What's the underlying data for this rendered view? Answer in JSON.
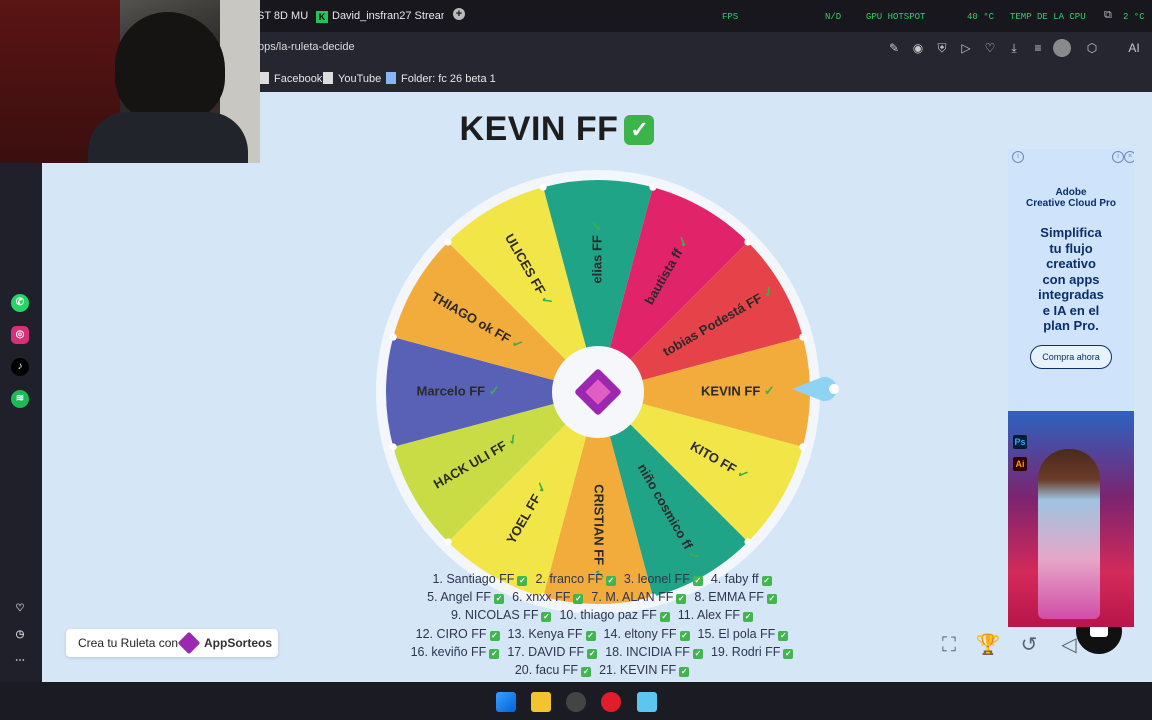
{
  "browser": {
    "tabs": [
      {
        "label": "ST 8D MU"
      },
      {
        "label": "David_insfran27 Stream -",
        "icon": "K"
      }
    ],
    "hud": {
      "fps_label": "FPS",
      "nd_label": "N/D",
      "gpu_label": "GPU HOTSPOT",
      "gpu_temp": "40 °C",
      "cpu_label": "TEMP DE LA CPU",
      "cpu_value": "2 °C"
    },
    "url": "pps/la-ruleta-decide",
    "ai_label": "AI",
    "bookmarks": [
      {
        "label": "Facebook"
      },
      {
        "label": "YouTube"
      },
      {
        "label": "Folder: fc 26 beta 1"
      }
    ]
  },
  "wheel": {
    "title": "KEVIN FF",
    "title_check": "✓",
    "accent": "#9c27b0",
    "pointer_color": "#8fd3f4",
    "segments": [
      {
        "label": "elias FF",
        "color": "#20a487"
      },
      {
        "label": "bautista ff",
        "color": "#e1246a"
      },
      {
        "label": "tobias Podestá FF",
        "color": "#e6424a"
      },
      {
        "label": "KEVIN FF",
        "color": "#f2ac3b"
      },
      {
        "label": "KITO FF",
        "color": "#f2e548"
      },
      {
        "label": "niño cosmico ff",
        "color": "#20a487"
      },
      {
        "label": "CRISTIAN FF",
        "color": "#f2ac3b"
      },
      {
        "label": "YOEL FF",
        "color": "#f2e548"
      },
      {
        "label": "HACK ULI FF",
        "color": "#c9dc45"
      },
      {
        "label": "Marcelo FF",
        "color": "#5861b6"
      },
      {
        "label": "THIAGO ok FF",
        "color": "#f2ac3b"
      },
      {
        "label": "ULICES FF",
        "color": "#f2e548"
      }
    ]
  },
  "participants": [
    [
      "1. Santiago FF",
      "2. franco FF",
      "3. leonel FF",
      "4. faby ff"
    ],
    [
      "5. Angel FF",
      "6. xnxx FF",
      "7. M. ALAN FF",
      "8. EMMA FF"
    ],
    [
      "9. NICOLAS FF",
      "10. thiago paz FF",
      "11. Alex FF"
    ],
    [
      "12. CIRO FF",
      "13. Kenya FF",
      "14. eltony FF",
      "15. El pola FF"
    ],
    [
      "16. keviño FF",
      "17. DAVID FF",
      "18. INCIDIA FF",
      "19. Rodri FF"
    ],
    [
      "20. facu FF",
      "21. KEVIN FF"
    ]
  ],
  "badge": {
    "prefix": "Crea tu Ruleta con",
    "brand": "AppSorteos"
  },
  "ad": {
    "brand_line1": "Adobe",
    "brand_line2": "Creative Cloud Pro",
    "headline": [
      "Simplifica",
      "tu flujo",
      "creativo",
      "con apps",
      "integradas",
      "e IA en el",
      "plan Pro."
    ],
    "cta": "Compra ahora",
    "ps": "Ps",
    "ai": "Ai"
  }
}
